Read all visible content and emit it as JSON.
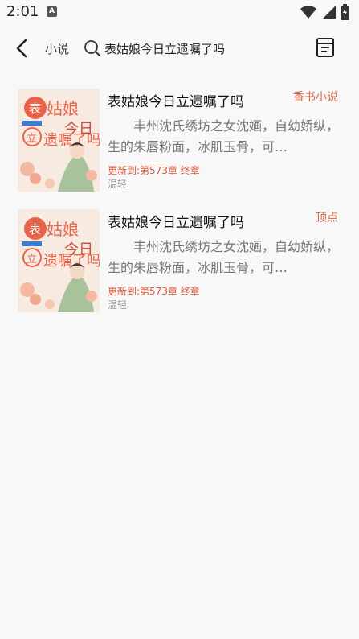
{
  "status_bar": {
    "time": "2:01",
    "notification_icon": "a-letter-icon",
    "icons": [
      "wifi-icon",
      "signal-icon",
      "battery-icon"
    ]
  },
  "toolbar": {
    "back_icon": "chevron-left-icon",
    "category": "小说",
    "search_query": "表姑娘今日立遗嘱了吗",
    "shelf_icon": "bookshelf-icon"
  },
  "results": [
    {
      "title": "表姑娘今日立遗嘱了吗",
      "source": "香书小说",
      "description": "丰州沈氏绣坊之女沈婳，自幼娇纵，生的朱唇粉面，冰肌玉骨，可…",
      "latest": "更新到:第573章 终章",
      "author": "温轻"
    },
    {
      "title": "表姑娘今日立遗嘱了吗",
      "source": "顶点",
      "description": "丰州沈氏绣坊之女沈婳，自幼娇纵，生的朱唇粉面，冰肌玉骨，可…",
      "latest": "更新到:第573章 终章",
      "author": "温轻"
    }
  ],
  "colors": {
    "background": "#f8f8f8",
    "accent": "#d86a4a",
    "latest": "#d8593c",
    "muted": "#999999"
  }
}
